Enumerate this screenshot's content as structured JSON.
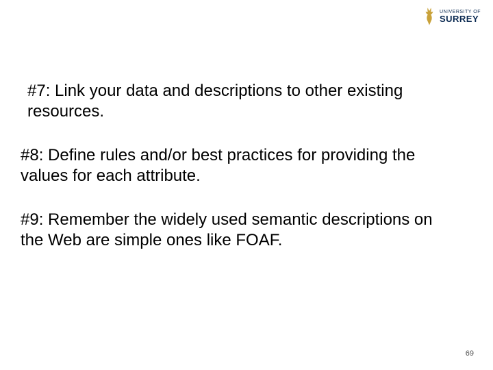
{
  "logo": {
    "line1": "UNIVERSITY OF",
    "line2": "SURREY"
  },
  "items": [
    " #7: Link your data and descriptions to other existing resources.",
    "#8: Define rules and/or best practices for providing the values for each attribute.",
    "#9: Remember the widely used semantic descriptions on the Web are simple ones like FOAF."
  ],
  "page_number": "69"
}
